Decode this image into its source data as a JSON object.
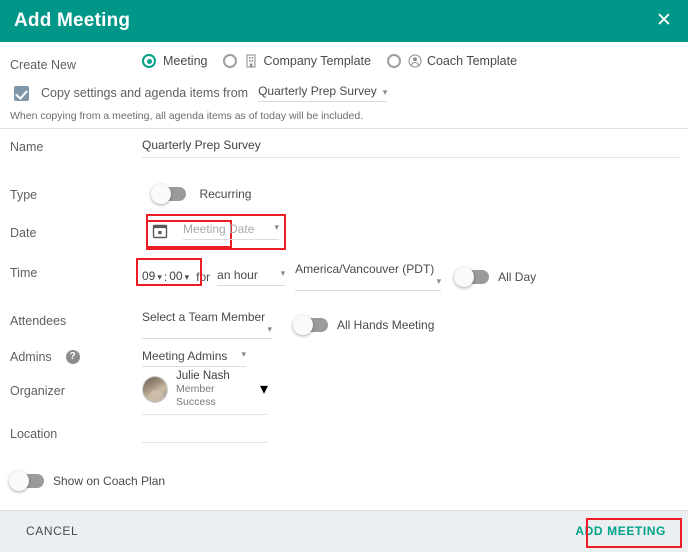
{
  "header": {
    "title": "Add Meeting",
    "close_label": "✕"
  },
  "create_new": {
    "label": "Create New",
    "options": [
      {
        "label": "Meeting",
        "selected": true,
        "icon": ""
      },
      {
        "label": "Company Template",
        "selected": false,
        "icon": "building-icon"
      },
      {
        "label": "Coach Template",
        "selected": false,
        "icon": "person-circle-icon"
      }
    ]
  },
  "copy_settings": {
    "checked": true,
    "label": "Copy settings and agenda items from",
    "source_value": "Quarterly Prep Survey",
    "note": "When copying from a meeting, all agenda items as of today will be included."
  },
  "name": {
    "label": "Name",
    "value": "Quarterly Prep Survey"
  },
  "type": {
    "label": "Type",
    "toggle_label": "Recurring",
    "toggle_on": false
  },
  "date": {
    "label": "Date",
    "placeholder": "Meeting Date",
    "value": "",
    "icon": "calendar-icon"
  },
  "time": {
    "label": "Time",
    "hour": "09",
    "separator": ":",
    "minute": "00",
    "for_label": "for",
    "duration": "an hour",
    "timezone": "America/Vancouver (PDT)",
    "all_day_label": "All Day",
    "all_day_on": false
  },
  "attendees": {
    "label": "Attendees",
    "select_placeholder": "Select a Team Member",
    "all_hands_label": "All Hands Meeting",
    "all_hands_on": false
  },
  "admins": {
    "label": "Admins",
    "help_glyph": "?",
    "select_value": "Meeting Admins"
  },
  "organizer": {
    "label": "Organizer",
    "person_name": "Julie Nash",
    "person_role": "Member Success"
  },
  "location": {
    "label": "Location",
    "value": ""
  },
  "coach_plan": {
    "toggle_label": "Show on Coach Plan",
    "toggle_on": false
  },
  "footer": {
    "cancel_label": "CANCEL",
    "submit_label": "ADD MEETING"
  },
  "colors": {
    "header_teal": "#009688",
    "accent_teal": "#00a388",
    "annotation_red": "#ee1c25",
    "checkbox_slate": "#7f97a8",
    "footer_grey": "#eceff1"
  }
}
